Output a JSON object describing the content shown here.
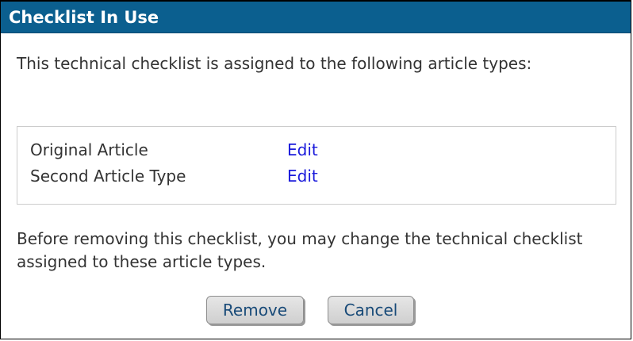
{
  "dialog": {
    "title": "Checklist In Use",
    "intro_text": "This technical checklist is assigned to the following article types:",
    "article_types": [
      {
        "name": "Original Article",
        "edit_label": "Edit"
      },
      {
        "name": "Second Article Type",
        "edit_label": "Edit"
      }
    ],
    "outro_text": "Before removing this checklist, you may change the technical checklist assigned to these article types.",
    "buttons": {
      "remove_label": "Remove",
      "cancel_label": "Cancel"
    }
  },
  "colors": {
    "titlebar_bg": "#0b5f8f",
    "link": "#1a1adb",
    "button_text": "#184a78"
  }
}
